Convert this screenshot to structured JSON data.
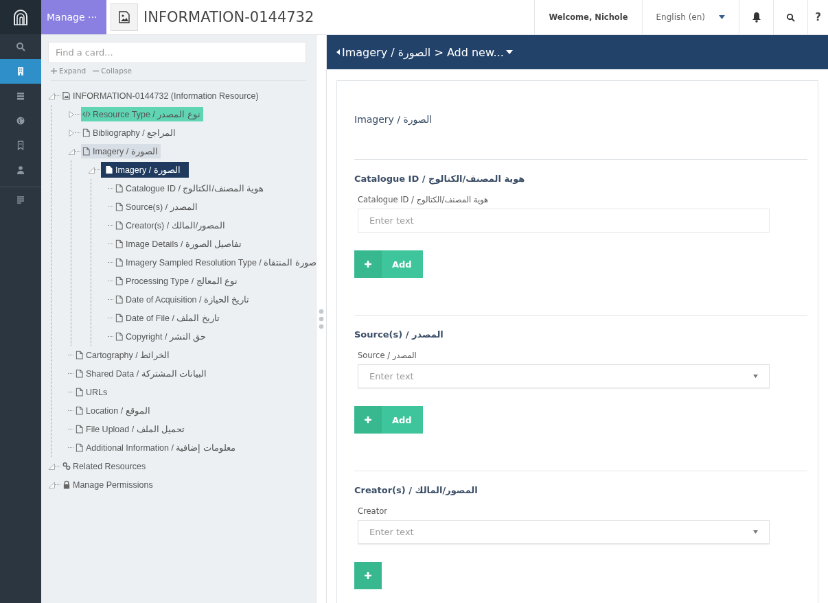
{
  "rail": [
    {
      "kind": "search",
      "selected": false
    },
    {
      "kind": "resource",
      "selected": true
    },
    {
      "kind": "list",
      "selected": false
    },
    {
      "kind": "globe",
      "selected": false
    },
    {
      "kind": "bookmark",
      "selected": false
    },
    {
      "kind": "person",
      "selected": false
    },
    {
      "kind": "lines",
      "selected": false
    }
  ],
  "header": {
    "manage_label": "Manage ···",
    "title": "INFORMATION-0144732",
    "welcome": "Welcome, Nichole",
    "language": "English (en)",
    "help_label": "?"
  },
  "tree_panel": {
    "search_placeholder": "Find a card...",
    "expand_label": "Expand",
    "collapse_label": "Collapse"
  },
  "tree": [
    {
      "label": "INFORMATION-0144732 (Information Resource)",
      "kind": "image",
      "expanded": true,
      "selected": false,
      "children": [
        {
          "label": "Resource Type / نوع المصدر",
          "kind": "code",
          "expanded": false,
          "selected": false,
          "color": "#5fd5b4"
        },
        {
          "label": "Bibliography / المراجع",
          "kind": "file",
          "expanded": false,
          "selected": false
        },
        {
          "label": "Imagery / الصورة",
          "kind": "file",
          "expanded": true,
          "selected": false,
          "color": "#d8dee5",
          "children": [
            {
              "label": "Imagery / الصورة",
              "kind": "file-solid",
              "expanded": true,
              "selected": true,
              "children": [
                {
                  "label": "Catalogue ID / هوية المصنف/الكتالوج",
                  "kind": "file",
                  "selected": false
                },
                {
                  "label": "Source(s) / المصدر",
                  "kind": "file",
                  "selected": false
                },
                {
                  "label": "Creator(s) / المصور/المالك",
                  "kind": "file",
                  "selected": false
                },
                {
                  "label": "Image Details / تفاصيل الصورة",
                  "kind": "file",
                  "selected": false
                },
                {
                  "label": "Imagery Sampled Resolution Type / صورة المنتقاة",
                  "kind": "file",
                  "selected": false
                },
                {
                  "label": "Processing Type / نوع المعالج",
                  "kind": "file",
                  "selected": false
                },
                {
                  "label": "Date of Acquisition / تاريخ الحيازة",
                  "kind": "file",
                  "selected": false
                },
                {
                  "label": "Date of File / تاريخ الملف",
                  "kind": "file",
                  "selected": false
                },
                {
                  "label": "Copyright / حق النشر",
                  "kind": "file",
                  "selected": false
                }
              ]
            }
          ]
        },
        {
          "label": "Cartography / الخرائط",
          "kind": "file",
          "selected": false
        },
        {
          "label": "Shared Data / البيانات المشتركة",
          "kind": "file",
          "selected": false
        },
        {
          "label": "URLs",
          "kind": "file",
          "selected": false
        },
        {
          "label": "Location / الموقع",
          "kind": "file",
          "selected": false
        },
        {
          "label": "File Upload / تحميل الملف",
          "kind": "file",
          "selected": false
        },
        {
          "label": "Additional Information / معلومات إضافية",
          "kind": "file",
          "selected": false
        }
      ]
    },
    {
      "label": "Related Resources",
      "kind": "link",
      "expanded": true,
      "selected": false
    },
    {
      "label": "Manage Permissions",
      "kind": "lock",
      "expanded": true,
      "selected": false
    }
  ],
  "breadcrumb": {
    "text": "Imagery / الصورة > Add new..."
  },
  "card": {
    "title": "Imagery / الصورة",
    "sections": [
      {
        "title": "Catalogue ID / هوية المصنف/الكتالوج",
        "field_label": "Catalogue ID / هوية المصنف/الكتالوج",
        "kind": "text",
        "placeholder": "Enter text",
        "add_label": "Add"
      },
      {
        "title": "Source(s) / المصدر",
        "field_label": "Source / المصدر",
        "kind": "select",
        "placeholder": "Enter text",
        "add_label": "Add"
      },
      {
        "title": "Creator(s) / المصور/المالك",
        "field_label": "Creator",
        "kind": "select",
        "placeholder": "Enter text"
      }
    ]
  }
}
